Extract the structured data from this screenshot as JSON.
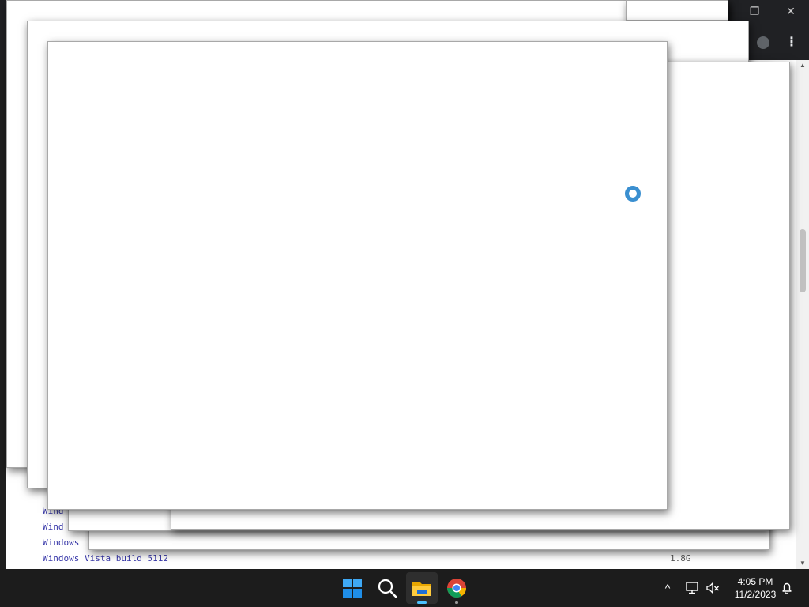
{
  "background": {
    "titlebar_controls": {
      "restore_glyph": "❐",
      "close_glyph": "✕"
    },
    "menu_glyph": "⋮",
    "listing_rows": [
      {
        "name": "Wind",
        "date": "",
        "size": ""
      },
      {
        "name": "Wind",
        "date": "",
        "size": ""
      },
      {
        "name": "Windows",
        "date": "",
        "size": ""
      },
      {
        "name": "Windows Vista build 5112",
        "date": "",
        "size": "1.8G"
      }
    ],
    "scroll_up_glyph": "▲",
    "scroll_down_glyph": "▼"
  },
  "loading": {
    "icon": "loading-ring-icon",
    "color": "#3a8fd0"
  },
  "taskbar": {
    "apps": [
      {
        "name": "start",
        "icon": "windows-start-icon"
      },
      {
        "name": "search",
        "icon": "search-icon"
      },
      {
        "name": "file-explorer",
        "icon": "folder-icon",
        "active": true
      },
      {
        "name": "chrome",
        "icon": "chrome-icon"
      }
    ],
    "accent_color": "#4cc2ff",
    "tray": {
      "chevron_glyph": "^",
      "time": "4:05 PM",
      "date": "11/2/2023"
    }
  }
}
